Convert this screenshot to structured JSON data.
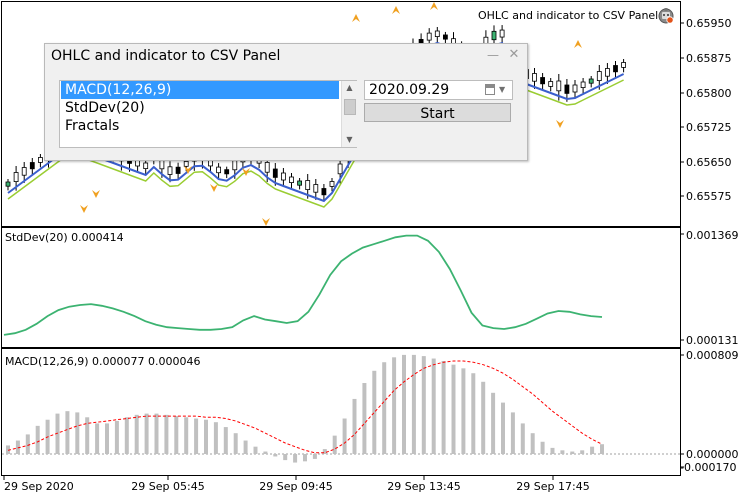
{
  "window": {
    "title": "OHLC and indicator to CSV Panel"
  },
  "price_axis": [
    "0.65950",
    "0.65875",
    "0.65800",
    "0.65725",
    "0.65650",
    "0.65575"
  ],
  "stddev_axis": [
    "0.001369",
    "0.000131"
  ],
  "macd_axis": [
    "0.000809",
    "0.000000",
    "-0.000170"
  ],
  "time_axis": [
    "29 Sep 2020",
    "29 Sep 05:45",
    "29 Sep 09:45",
    "29 Sep 13:45",
    "29 Sep 17:45"
  ],
  "stddev_pane": {
    "title": "StdDev(20) 0.000414"
  },
  "macd_pane": {
    "title": "MACD(12,26,9) 0.000077 0.000046"
  },
  "panel": {
    "title": "OHLC and indicator to CSV Panel",
    "indicators": [
      {
        "label": "MACD(12,26,9)",
        "selected": true
      },
      {
        "label": "StdDev(20)",
        "selected": false
      },
      {
        "label": "Fractals",
        "selected": false
      }
    ],
    "date_value": "2020.09.29",
    "start_label": "Start",
    "minimize_glyph": "—",
    "close_glyph": "✕"
  },
  "icons": {
    "robot": "expert-advisor-icon",
    "calendar": "calendar-icon"
  },
  "colors": {
    "candle_bull": "#000000",
    "candle_bear": "#000000",
    "candle_fill": "#ffffff",
    "ma_fast": "#3a5fcd",
    "ma_slow": "#9acd32",
    "fractal": "#f0a020",
    "stddev_line": "#3cb371",
    "macd_hist": "#c0c0c0",
    "macd_signal": "#ff0000",
    "selection": "#3399ff"
  },
  "chart_data": [
    {
      "type": "line",
      "title": "StdDev(20) 0.000414",
      "ylim": [
        0.000131,
        0.001369
      ],
      "series": [
        {
          "name": "StdDev(20)",
          "values": [
            0.00019,
            0.00021,
            0.00025,
            0.00032,
            0.00041,
            0.00048,
            0.00052,
            0.00054,
            0.00055,
            0.00053,
            0.0005,
            0.00046,
            0.00041,
            0.00035,
            0.00031,
            0.00028,
            0.00027,
            0.00026,
            0.00025,
            0.00025,
            0.00026,
            0.00028,
            0.00036,
            0.00041,
            0.00037,
            0.00035,
            0.00033,
            0.00035,
            0.00046,
            0.00066,
            0.00089,
            0.00105,
            0.00114,
            0.00121,
            0.00125,
            0.00129,
            0.00133,
            0.00135,
            0.00135,
            0.00129,
            0.00116,
            0.00096,
            0.00071,
            0.00045,
            0.0003,
            0.00027,
            0.00026,
            0.00028,
            0.00032,
            0.00038,
            0.00044,
            0.00047,
            0.00046,
            0.00043,
            0.00041,
            0.0004
          ]
        }
      ]
    },
    {
      "type": "bar",
      "title": "MACD(12,26,9) 0.000077 0.000046",
      "ylim": [
        -0.00017,
        0.000809
      ],
      "series": [
        {
          "name": "MACD(12,26,9)",
          "values": [
            7e-05,
            0.00011,
            0.00016,
            0.00023,
            0.00028,
            0.00033,
            0.00035,
            0.00034,
            0.0003,
            0.00025,
            0.00025,
            0.00027,
            0.0003,
            0.00032,
            0.00033,
            0.00033,
            0.00032,
            0.00031,
            0.0003,
            0.00029,
            0.00028,
            0.00026,
            0.00022,
            0.00017,
            0.00011,
            6e-05,
            2e-05,
            -2e-05,
            -5e-05,
            -7e-05,
            -6e-05,
            -4e-05,
            4e-05,
            0.00015,
            0.00029,
            0.00045,
            0.00058,
            0.00068,
            0.00075,
            0.00079,
            0.00081,
            0.00081,
            0.0008,
            0.00078,
            0.00076,
            0.00073,
            0.0007,
            0.00066,
            0.00059,
            0.0005,
            0.00042,
            0.00034,
            0.00025,
            0.00017,
            0.0001,
            5e-05,
            3e-05,
            2e-05,
            3e-05,
            6e-05,
            8e-05
          ]
        },
        {
          "name": "Signal",
          "values": [
            3e-05,
            5e-05,
            7e-05,
            0.0001,
            0.00014,
            0.00017,
            0.0002,
            0.00023,
            0.00025,
            0.00026,
            0.00027,
            0.00028,
            0.00029,
            0.0003,
            0.00031,
            0.00031,
            0.00031,
            0.00031,
            0.00031,
            0.00031,
            0.0003,
            0.0003,
            0.00029,
            0.00027,
            0.00024,
            0.00021,
            0.00017,
            0.00013,
            9e-05,
            6e-05,
            3e-05,
            1e-05,
            1e-05,
            4e-05,
            9e-05,
            0.00016,
            0.00025,
            0.00034,
            0.00043,
            0.00052,
            0.00059,
            0.00065,
            0.0007,
            0.00073,
            0.00075,
            0.00076,
            0.00076,
            0.00075,
            0.00073,
            0.0007,
            0.00066,
            0.00061,
            0.00055,
            0.00049,
            0.00042,
            0.00035,
            0.00029,
            0.00023,
            0.00017,
            0.00012,
            8e-05
          ]
        }
      ]
    }
  ]
}
